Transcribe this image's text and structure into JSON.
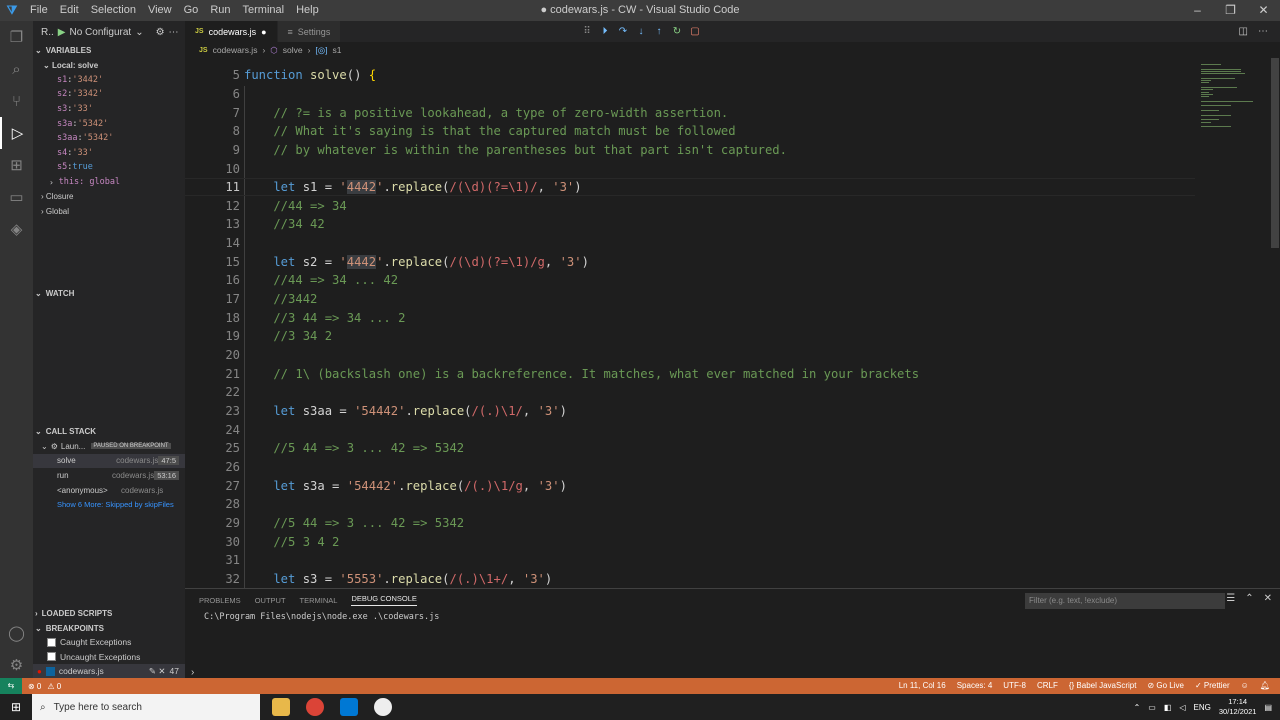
{
  "window": {
    "title": "● codewars.js - CW - Visual Studio Code",
    "menu": [
      "File",
      "Edit",
      "Selection",
      "View",
      "Go",
      "Run",
      "Terminal",
      "Help"
    ]
  },
  "sidebar": {
    "run_label": "R..",
    "config": "No Configurat",
    "variables_header": "VARIABLES",
    "local_scope": "Local: solve",
    "variables": [
      {
        "name": "s1",
        "value": "'3442'",
        "type": "string"
      },
      {
        "name": "s2",
        "value": "'3342'",
        "type": "string"
      },
      {
        "name": "s3",
        "value": "'33'",
        "type": "string"
      },
      {
        "name": "s3a",
        "value": "'5342'",
        "type": "string"
      },
      {
        "name": "s3aa",
        "value": "'5342'",
        "type": "string"
      },
      {
        "name": "s4",
        "value": "'33'",
        "type": "string"
      },
      {
        "name": "s5",
        "value": "true",
        "type": "bool"
      }
    ],
    "this_row": "this: global",
    "closure": "Closure",
    "global": "Global",
    "watch_header": "WATCH",
    "callstack_header": "CALL STACK",
    "launch_label": "Laun...",
    "paused_badge": "PAUSED ON BREAKPOINT",
    "frames": [
      {
        "fn": "solve",
        "file": "codewars.js",
        "line": "47:5"
      },
      {
        "fn": "run",
        "file": "codewars.js",
        "line": "53:16"
      },
      {
        "fn": "<anonymous>",
        "file": "codewars.js",
        "line": ""
      }
    ],
    "show_more": "Show 6 More: Skipped by skipFiles",
    "loaded_scripts": "LOADED SCRIPTS",
    "breakpoints_header": "BREAKPOINTS",
    "breakpoints": [
      {
        "label": "Caught Exceptions",
        "checked": false
      },
      {
        "label": "Uncaught Exceptions",
        "checked": false
      },
      {
        "label": "codewars.js",
        "checked": true,
        "count": "47"
      }
    ]
  },
  "tabs": [
    {
      "label": "codewars.js",
      "active": true,
      "badge": "JS"
    },
    {
      "label": "Settings",
      "active": false,
      "badge": "≡"
    }
  ],
  "breadcrumb": [
    "codewars.js",
    "solve",
    "s1"
  ],
  "editor": {
    "current_line": 11,
    "lines": [
      {
        "n": 5,
        "tokens": [
          [
            "kw",
            "function "
          ],
          [
            "fn",
            "solve"
          ],
          [
            "txt",
            "() "
          ],
          [
            "brk",
            "{"
          ]
        ]
      },
      {
        "n": 6,
        "tokens": []
      },
      {
        "n": 7,
        "tokens": [
          [
            "cm",
            "    // ?= is a positive lookahead, a type of zero-width assertion."
          ]
        ]
      },
      {
        "n": 8,
        "tokens": [
          [
            "cm",
            "    // What it's saying is that the captured match must be followed"
          ]
        ]
      },
      {
        "n": 9,
        "tokens": [
          [
            "cm",
            "    // by whatever is within the parentheses but that part isn't captured."
          ]
        ]
      },
      {
        "n": 10,
        "tokens": []
      },
      {
        "n": 11,
        "tokens": [
          [
            "kw",
            "    let "
          ],
          [
            "txt",
            "s1 = "
          ],
          [
            "str",
            "'"
          ],
          [
            "strhl",
            "4442"
          ],
          [
            "str",
            "'"
          ],
          [
            "txt",
            "."
          ],
          [
            "fn",
            "replace"
          ],
          [
            "txt",
            "("
          ],
          [
            "re",
            "/(\\d)(?=\\1)/"
          ],
          [
            "txt",
            ", "
          ],
          [
            "str",
            "'3'"
          ],
          [
            "txt",
            ")"
          ]
        ]
      },
      {
        "n": 12,
        "tokens": [
          [
            "cm",
            "    //44 => 34"
          ]
        ]
      },
      {
        "n": 13,
        "tokens": [
          [
            "cm",
            "    //34 42"
          ]
        ]
      },
      {
        "n": 14,
        "tokens": []
      },
      {
        "n": 15,
        "tokens": [
          [
            "kw",
            "    let "
          ],
          [
            "txt",
            "s2 = "
          ],
          [
            "str",
            "'"
          ],
          [
            "strhl",
            "4442"
          ],
          [
            "str",
            "'"
          ],
          [
            "txt",
            "."
          ],
          [
            "fn",
            "replace"
          ],
          [
            "txt",
            "("
          ],
          [
            "re",
            "/(\\d)(?=\\1)/g"
          ],
          [
            "txt",
            ", "
          ],
          [
            "str",
            "'3'"
          ],
          [
            "txt",
            ")"
          ]
        ]
      },
      {
        "n": 16,
        "tokens": [
          [
            "cm",
            "    //44 => 34 ... 42"
          ]
        ]
      },
      {
        "n": 17,
        "tokens": [
          [
            "cm",
            "    //3442"
          ]
        ]
      },
      {
        "n": 18,
        "tokens": [
          [
            "cm",
            "    //3 44 => 34 ... 2"
          ]
        ]
      },
      {
        "n": 19,
        "tokens": [
          [
            "cm",
            "    //3 34 2"
          ]
        ]
      },
      {
        "n": 20,
        "tokens": []
      },
      {
        "n": 21,
        "tokens": [
          [
            "cm",
            "    // 1\\ (backslash one) is a backreference. It matches, what ever matched in your brackets"
          ]
        ]
      },
      {
        "n": 22,
        "tokens": []
      },
      {
        "n": 23,
        "tokens": [
          [
            "kw",
            "    let "
          ],
          [
            "txt",
            "s3aa = "
          ],
          [
            "str",
            "'54442'"
          ],
          [
            "txt",
            "."
          ],
          [
            "fn",
            "replace"
          ],
          [
            "txt",
            "("
          ],
          [
            "re",
            "/(.)\\1/"
          ],
          [
            "txt",
            ", "
          ],
          [
            "str",
            "'3'"
          ],
          [
            "txt",
            ")"
          ]
        ]
      },
      {
        "n": 24,
        "tokens": []
      },
      {
        "n": 25,
        "tokens": [
          [
            "cm",
            "    //5 44 => 3 ... 42 => 5342"
          ]
        ]
      },
      {
        "n": 26,
        "tokens": []
      },
      {
        "n": 27,
        "tokens": [
          [
            "kw",
            "    let "
          ],
          [
            "txt",
            "s3a = "
          ],
          [
            "str",
            "'54442'"
          ],
          [
            "txt",
            "."
          ],
          [
            "fn",
            "replace"
          ],
          [
            "txt",
            "("
          ],
          [
            "re",
            "/(.)\\1/g"
          ],
          [
            "txt",
            ", "
          ],
          [
            "str",
            "'3'"
          ],
          [
            "txt",
            ")"
          ]
        ]
      },
      {
        "n": 28,
        "tokens": []
      },
      {
        "n": 29,
        "tokens": [
          [
            "cm",
            "    //5 44 => 3 ... 42 => 5342"
          ]
        ]
      },
      {
        "n": 30,
        "tokens": [
          [
            "cm",
            "    //5 3 4 2"
          ]
        ]
      },
      {
        "n": 31,
        "tokens": []
      },
      {
        "n": 32,
        "tokens": [
          [
            "kw",
            "    let "
          ],
          [
            "txt",
            "s3 = "
          ],
          [
            "str",
            "'5553'"
          ],
          [
            "txt",
            "."
          ],
          [
            "fn",
            "replace"
          ],
          [
            "txt",
            "("
          ],
          [
            "re",
            "/(.)\\1+/"
          ],
          [
            "txt",
            ", "
          ],
          [
            "str",
            "'3'"
          ],
          [
            "txt",
            ")"
          ]
        ]
      }
    ]
  },
  "panel": {
    "tabs": [
      "PROBLEMS",
      "OUTPUT",
      "TERMINAL",
      "DEBUG CONSOLE"
    ],
    "active_tab": "DEBUG CONSOLE",
    "filter_placeholder": "Filter (e.g. text, !exclude)",
    "console_line": "C:\\Program Files\\nodejs\\node.exe .\\codewars.js",
    "prompt": "›"
  },
  "status": {
    "errors": "⊗ 0",
    "warnings": "⚠ 0",
    "position": "Ln 11, Col 16",
    "spaces": "Spaces: 4",
    "encoding": "UTF-8",
    "eol": "CRLF",
    "language": "{} Babel JavaScript",
    "golive": "⊘ Go Live",
    "prettier": "✓ Prettier"
  },
  "taskbar": {
    "search_placeholder": "Type here to search",
    "lang": "ENG",
    "time": "17:14",
    "date": "30/12/2021"
  },
  "colors": {
    "status_bg": "#cc6633",
    "editor_bg": "#1e1e1e",
    "sidebar_bg": "#252526"
  }
}
